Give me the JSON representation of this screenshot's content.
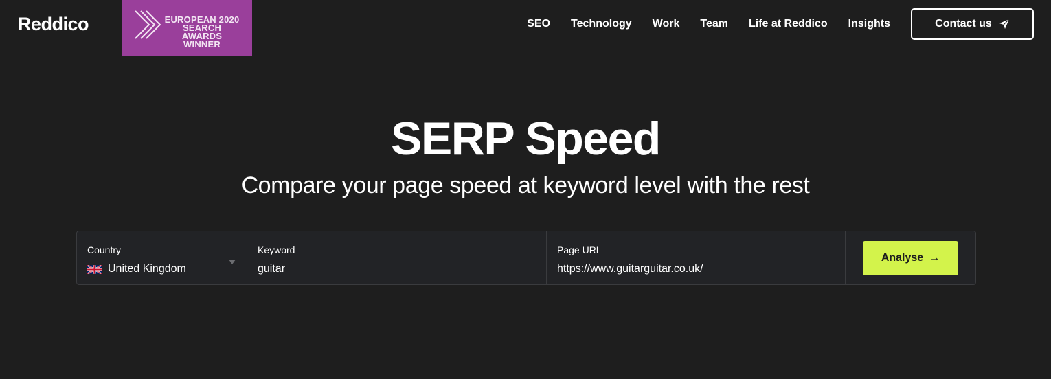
{
  "brand": {
    "logo_text": "Reddico"
  },
  "award": {
    "line1": "EUROPEAN 2020",
    "line2": "SEARCH AWARDS",
    "line3": "WINNER",
    "bg_color": "#9a3f9b"
  },
  "nav": {
    "items": [
      {
        "label": "SEO"
      },
      {
        "label": "Technology"
      },
      {
        "label": "Work"
      },
      {
        "label": "Team"
      },
      {
        "label": "Life at Reddico"
      },
      {
        "label": "Insights"
      }
    ],
    "contact_label": "Contact us",
    "contact_icon": "paper-plane-icon"
  },
  "hero": {
    "title": "SERP Speed",
    "subtitle": "Compare your page speed at keyword level with the rest"
  },
  "form": {
    "country": {
      "label": "Country",
      "value": "United Kingdom",
      "flag_icon": "uk-flag-icon"
    },
    "keyword": {
      "label": "Keyword",
      "value": "guitar"
    },
    "page_url": {
      "label": "Page URL",
      "value": "https://www.guitarguitar.co.uk/"
    },
    "submit": {
      "label": "Analyse",
      "icon": "arrow-right-icon",
      "color": "#d3f34b"
    }
  },
  "colors": {
    "background": "#1e1e1e",
    "accent": "#d3f34b"
  }
}
